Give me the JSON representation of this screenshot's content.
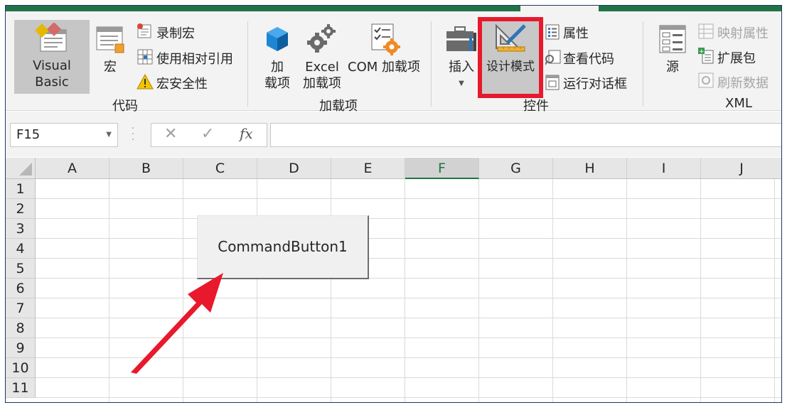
{
  "ribbon": {
    "code_group": {
      "visual_basic": "Visual Basic",
      "macros": "宏",
      "record_macro": "录制宏",
      "use_relative_refs": "使用相对引用",
      "macro_security": "宏安全性",
      "label": "代码"
    },
    "addins_group": {
      "addins_line1": "加",
      "addins_line2": "载项",
      "excel_addins_line1": "Excel",
      "excel_addins_line2": "加载项",
      "com_addins": "COM 加载项",
      "label": "加载项"
    },
    "controls_group": {
      "insert": "插入",
      "design_mode": "设计模式",
      "properties": "属性",
      "view_code": "查看代码",
      "run_dialog": "运行对话框",
      "label": "控件"
    },
    "xml_group": {
      "source": "源",
      "map_properties": "映射属性",
      "expansion_packs": "扩展包",
      "refresh_data": "刷新数据",
      "label": "XML"
    }
  },
  "formula_bar": {
    "name_box": "F15",
    "cancel_icon": "✕",
    "enter_icon": "✓",
    "fx_label": "fx",
    "formula": ""
  },
  "sheet": {
    "columns": [
      "A",
      "B",
      "C",
      "D",
      "E",
      "F",
      "G",
      "H",
      "I",
      "J"
    ],
    "rows": [
      "1",
      "2",
      "3",
      "4",
      "5",
      "6",
      "7",
      "8",
      "9",
      "10",
      "11"
    ],
    "selected_column": "F",
    "command_button": "CommandButton1"
  },
  "colors": {
    "excel_green": "#217346",
    "highlight_red": "#e8192c"
  }
}
